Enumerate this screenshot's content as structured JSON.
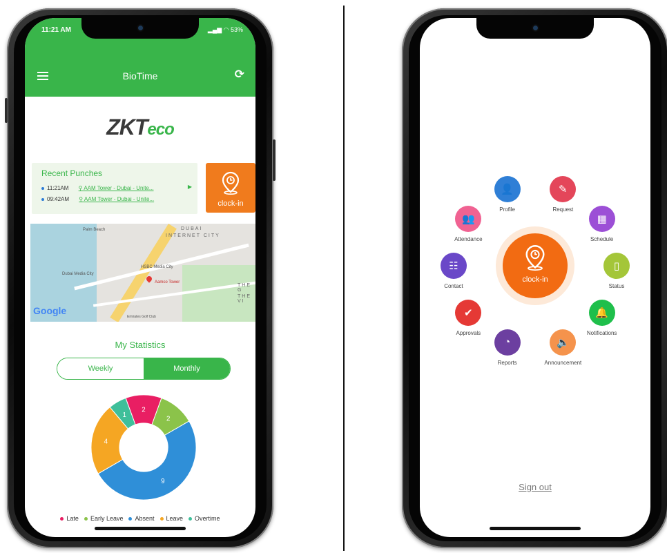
{
  "left": {
    "status": {
      "time": "11:21 AM",
      "signal": "53%"
    },
    "appbar": {
      "title": "BioTime"
    },
    "logo": {
      "main": "ZKT",
      "accent": "eco"
    },
    "recent": {
      "title": "Recent Punches",
      "rows": [
        {
          "time": "11:21AM",
          "location": "AAM Tower - Dubai - Unite..."
        },
        {
          "time": "09:42AM",
          "location": "AAM Tower - Dubai - Unite..."
        }
      ]
    },
    "clock_in": "clock-in",
    "map": {
      "labels": [
        "Palm Beach",
        "DUBAI",
        "INTERNET CITY",
        "Dubai Media City",
        "HSBC Media City",
        "Aamco Tower",
        "THE G",
        "THE VI",
        "Emirates Golf Club",
        "Google"
      ]
    },
    "stats": {
      "title": "My Statistics",
      "tabs": {
        "weekly": "Weekly",
        "monthly": "Monthly"
      },
      "active_tab": "Monthly"
    },
    "chart_data": {
      "type": "pie",
      "categories": [
        "Late",
        "Early Leave",
        "Absent",
        "Leave",
        "Overtime"
      ],
      "values": [
        2,
        2,
        9,
        4,
        1
      ],
      "colors": [
        "#e91e63",
        "#8bc34a",
        "#2f8fd8",
        "#f5a623",
        "#3fbf9a"
      ]
    }
  },
  "right": {
    "items": [
      {
        "label": "Profile",
        "color": "#2f7fd6",
        "icon": "person-icon"
      },
      {
        "label": "Request",
        "color": "#e4465a",
        "icon": "document-edit-icon"
      },
      {
        "label": "Schedule",
        "color": "#9c4fd6",
        "icon": "calendar-icon"
      },
      {
        "label": "Status",
        "color": "#a4c639",
        "icon": "book-icon"
      },
      {
        "label": "Notifications",
        "color": "#1fbf4b",
        "icon": "bell-icon"
      },
      {
        "label": "Announcement",
        "color": "#f5934c",
        "icon": "speaker-icon"
      },
      {
        "label": "Reports",
        "color": "#6c3fa0",
        "icon": "reports-icon"
      },
      {
        "label": "Approvals",
        "color": "#e53935",
        "icon": "approval-icon"
      },
      {
        "label": "Contact",
        "color": "#6a48c8",
        "icon": "contact-card-icon"
      },
      {
        "label": "Attendance",
        "color": "#f06292",
        "icon": "group-icon"
      }
    ],
    "clock_in": "clock-in",
    "sign_out": "Sign out"
  }
}
